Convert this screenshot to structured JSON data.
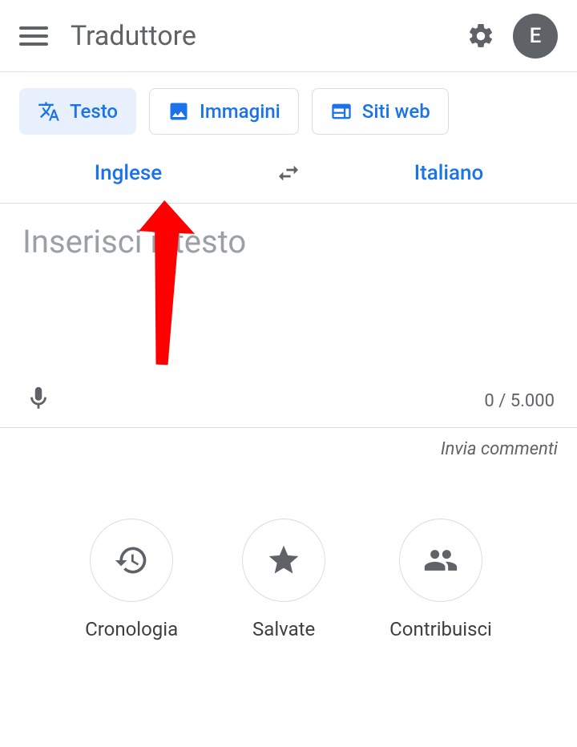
{
  "header": {
    "title": "Traduttore",
    "avatar_letter": "E"
  },
  "tabs": {
    "text": "Testo",
    "images": "Immagini",
    "websites": "Siti web"
  },
  "languages": {
    "source": "Inglese",
    "target": "Italiano"
  },
  "input": {
    "placeholder": "Inserisci il testo",
    "counter": "0 / 5.000"
  },
  "feedback_label": "Invia commenti",
  "bottom": {
    "history": "Cronologia",
    "saved": "Salvate",
    "contribute": "Contribuisci"
  }
}
